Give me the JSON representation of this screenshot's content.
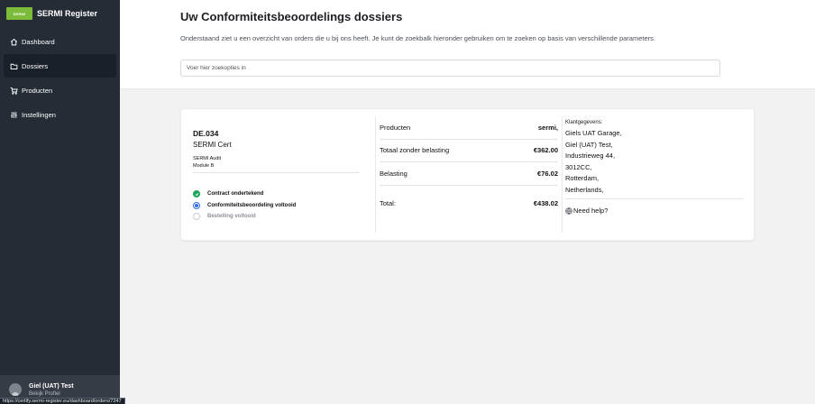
{
  "brand": {
    "logo_text": "SERMI",
    "title": "SERMI Register"
  },
  "nav": [
    {
      "label": "Dashboard",
      "icon": "home-icon",
      "active": false
    },
    {
      "label": "Dossiers",
      "icon": "folder-icon",
      "active": true
    },
    {
      "label": "Producten",
      "icon": "cart-icon",
      "active": false
    },
    {
      "label": "Instellingen",
      "icon": "sliders-icon",
      "active": false
    }
  ],
  "user": {
    "name": "Giel (UAT) Test",
    "profile_link": "Bekijk Profiel"
  },
  "status_url": "https://certify.sermi-register.eu/dashboard/orders/7247",
  "header": {
    "title": "Uw Conformiteitsbeoordelings dossiers",
    "subtitle": "Onderstaand ziet u een overzicht van orders die u bij ons heeft. Je kunt de zoekbalk hieronder gebruiken om te zoeken op basis van verschillende parameters.",
    "search_placeholder": "Voer hier zoekopties in"
  },
  "order": {
    "id": "DE.034",
    "name": "SERMI Cert",
    "sub_line1": "SERMI Audit",
    "sub_line2": "Module B",
    "steps": [
      {
        "label": "Contract ondertekend",
        "state": "done"
      },
      {
        "label": "Conformiteitsbeoordeling voltooid",
        "state": "current"
      },
      {
        "label": "Bestelling voltooid",
        "state": "pending"
      }
    ],
    "summary": {
      "products_label": "Producten",
      "products_value": "sermi,",
      "subtotal_label": "Totaal zonder belasting",
      "subtotal_value": "€362.00",
      "tax_label": "Belasting",
      "tax_value": "€76.02",
      "total_label": "Total:",
      "total_value": "€438.02"
    },
    "customer": {
      "label": "Klantgegevens:",
      "lines": [
        "Giels UAT Garage,",
        "Giel (UAT) Test,",
        "Industrieweg 44,",
        "3012CC,",
        "Rotterdam,",
        "Netherlands,"
      ]
    },
    "help": "Need help?"
  },
  "colors": {
    "sidebar": "#252c36",
    "active_nav": "#1a2029",
    "brand_green": "#7dbb3a",
    "step_done": "#1ea55b",
    "step_current": "#2f6fe0"
  }
}
